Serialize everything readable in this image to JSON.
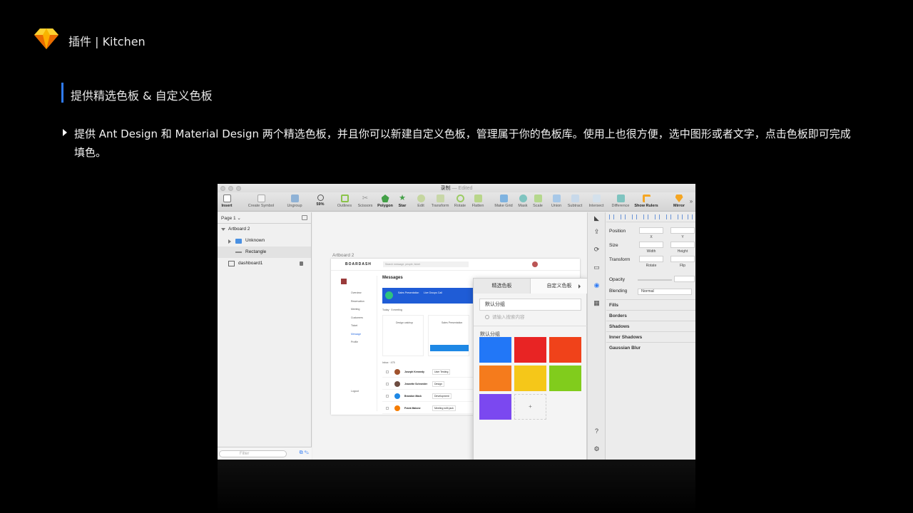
{
  "slide": {
    "title": "插件 | Kitchen",
    "section_title": "提供精选色板 & 自定义色板",
    "description": "提供 Ant Design 和 Material Design 两个精选色板，并且你可以新建自定义色板，管理属于你的色板库。使用上也很方便，选中图形或者文字，点击色板即可完成填色。"
  },
  "window": {
    "doc_name": "录制",
    "doc_status": "— Edited",
    "toolbar": [
      {
        "label": "Insert",
        "icon": "plus-icon"
      },
      {
        "label": "Create Symbol",
        "icon": "symbol-icon"
      },
      {
        "label": "Ungroup",
        "icon": "ungroup-icon"
      },
      {
        "label": "59%",
        "icon": "zoom-icon"
      },
      {
        "label": "Outlines",
        "icon": "outlines-icon"
      },
      {
        "label": "Scissors",
        "icon": "scissors-icon"
      },
      {
        "label": "Polygon",
        "icon": "polygon-icon"
      },
      {
        "label": "Star",
        "icon": "star-icon"
      },
      {
        "label": "Edit",
        "icon": "edit-icon"
      },
      {
        "label": "Transform",
        "icon": "transform-icon"
      },
      {
        "label": "Rotate",
        "icon": "rotate-icon"
      },
      {
        "label": "Flatten",
        "icon": "flatten-icon"
      },
      {
        "label": "Make Grid",
        "icon": "grid-icon"
      },
      {
        "label": "Mask",
        "icon": "mask-icon"
      },
      {
        "label": "Scale",
        "icon": "scale-icon"
      },
      {
        "label": "Union",
        "icon": "union-icon"
      },
      {
        "label": "Subtract",
        "icon": "subtract-icon"
      },
      {
        "label": "Intersect",
        "icon": "intersect-icon"
      },
      {
        "label": "Difference",
        "icon": "difference-icon"
      },
      {
        "label": "Show Rulers",
        "icon": "rulers-icon"
      },
      {
        "label": "Mirror",
        "icon": "mirror-icon"
      }
    ]
  },
  "layers": {
    "page": "Page 1",
    "items": [
      {
        "label": "Artboard 2"
      },
      {
        "label": "Unknown"
      },
      {
        "label": "Rectangle"
      },
      {
        "label": "dashboard1"
      }
    ],
    "filter_placeholder": "Filter"
  },
  "canvas": {
    "artboard_label": "Artboard 2",
    "dashboard": {
      "brand": "BOARDASH",
      "search": "Search message, people, ticket",
      "heading": "Messages",
      "banner_title": "Sales Presentation",
      "banner_sub": "Live Groups Call",
      "today": "Today · 5 meeting",
      "card1": "Design catchup",
      "card2": "Sales Presentation",
      "inbox": "Inbox · 475",
      "nav": [
        "Overview",
        "Reservation",
        "Meeting",
        "Customers",
        "Ticket",
        "Message",
        "Profile"
      ],
      "logout": "Logout",
      "rows": [
        {
          "name": "Joseph Kennedy",
          "tag": "User Testing"
        },
        {
          "name": "Jeanette Schneider",
          "tag": "Design"
        },
        {
          "name": "Brandon Mack",
          "tag": "Development"
        },
        {
          "name": "Frank Malone",
          "tag": "Meeting with jack"
        }
      ]
    }
  },
  "palette_popover": {
    "tab_curated": "精选色板",
    "tab_custom": "自定义色板",
    "group_name": "默认分组",
    "search_placeholder": "请输入搜索内容",
    "group_label": "默认分组",
    "swatches": [
      "#2277f7",
      "#e82424",
      "#f0421a",
      "#f57b1c",
      "#f5c719",
      "#81cc1c",
      "#7b48f0"
    ],
    "add_label": "+"
  },
  "inspector": {
    "position": "Position",
    "x": "X",
    "y": "Y",
    "size": "Size",
    "width": "Width",
    "height": "Height",
    "transform": "Transform",
    "rotate": "Rotate",
    "flip": "Flip",
    "opacity": "Opacity",
    "blending": "Blending",
    "blending_value": "Normal",
    "fills": "Fills",
    "borders": "Borders",
    "shadows": "Shadows",
    "inner_shadows": "Inner Shadows",
    "gaussian_blur": "Gaussian Blur"
  }
}
